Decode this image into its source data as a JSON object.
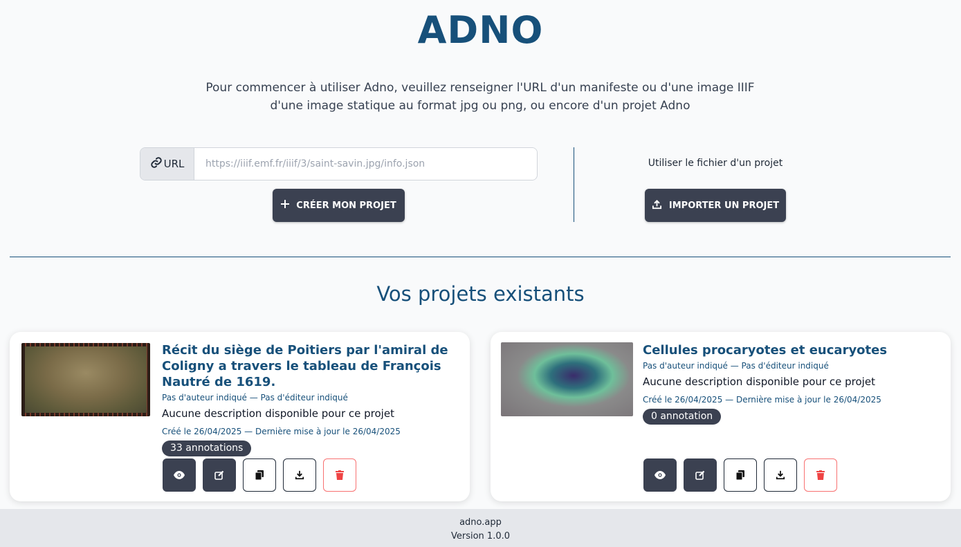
{
  "app": {
    "logo": "ADNO"
  },
  "intro": "Pour commencer à utiliser Adno, veuillez renseigner l'URL d'un manifeste ou d'une image IIIF d'une image statique au format jpg ou png, ou encore d'un projet Adno",
  "url_form": {
    "label": "URL",
    "placeholder": "https://iiif.emf.fr/iiif/3/saint-savin.jpg/info.json",
    "create_button": "CRÉER MON PROJET"
  },
  "import": {
    "label": "Utiliser le fichier d'un projet",
    "button": "IMPORTER UN PROJET"
  },
  "projects_title": "Vos projets existants",
  "projects": [
    {
      "title": "Récit du siège de Poitiers par l'amiral de Coligny a travers le tableau de François Nautré de 1619.",
      "meta": "Pas d'auteur indiqué — Pas d'éditeur indiqué",
      "description": "Aucune description disponible pour ce projet",
      "dates": "Créé le 26/04/2025 — Dernière mise à jour le 26/04/2025",
      "annotations": "33 annotations"
    },
    {
      "title": "Cellules procaryotes et eucaryotes",
      "meta": "Pas d'auteur indiqué — Pas d'éditeur indiqué",
      "description": "Aucune description disponible pour ce projet",
      "dates": "Créé le 26/04/2025 — Dernière mise à jour le 26/04/2025",
      "annotations": "0 annotation"
    }
  ],
  "footer": {
    "site": "adno.app",
    "version": "Version 1.0.0"
  }
}
